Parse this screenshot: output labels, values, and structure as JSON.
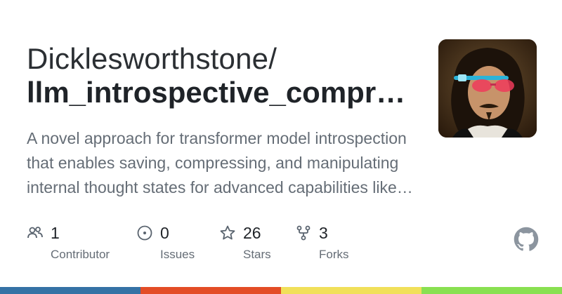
{
  "repo_card": {
    "owner": "Dicklesworthstone/",
    "repo_name": "llm_introspective_compr…",
    "description": "A novel approach for transformer model introspection that enables saving, compressing, and manipulating internal thought states for advanced capabilities like…",
    "avatar_icon": "portrait-with-glasses-avatar"
  },
  "stats": [
    {
      "icon": "people-icon",
      "value": "1",
      "label": "Contributor"
    },
    {
      "icon": "issue-circle-icon",
      "value": "0",
      "label": "Issues"
    },
    {
      "icon": "star-icon",
      "value": "26",
      "label": "Stars"
    },
    {
      "icon": "fork-icon",
      "value": "3",
      "label": "Forks"
    }
  ],
  "brand": {
    "logo_icon": "github-logo-icon"
  },
  "colors": {
    "text_primary": "#1f2328",
    "text_secondary": "#656d76",
    "accent_bar": [
      "#3572A5",
      "#e34c26",
      "#f1e05a",
      "#89e051"
    ]
  }
}
